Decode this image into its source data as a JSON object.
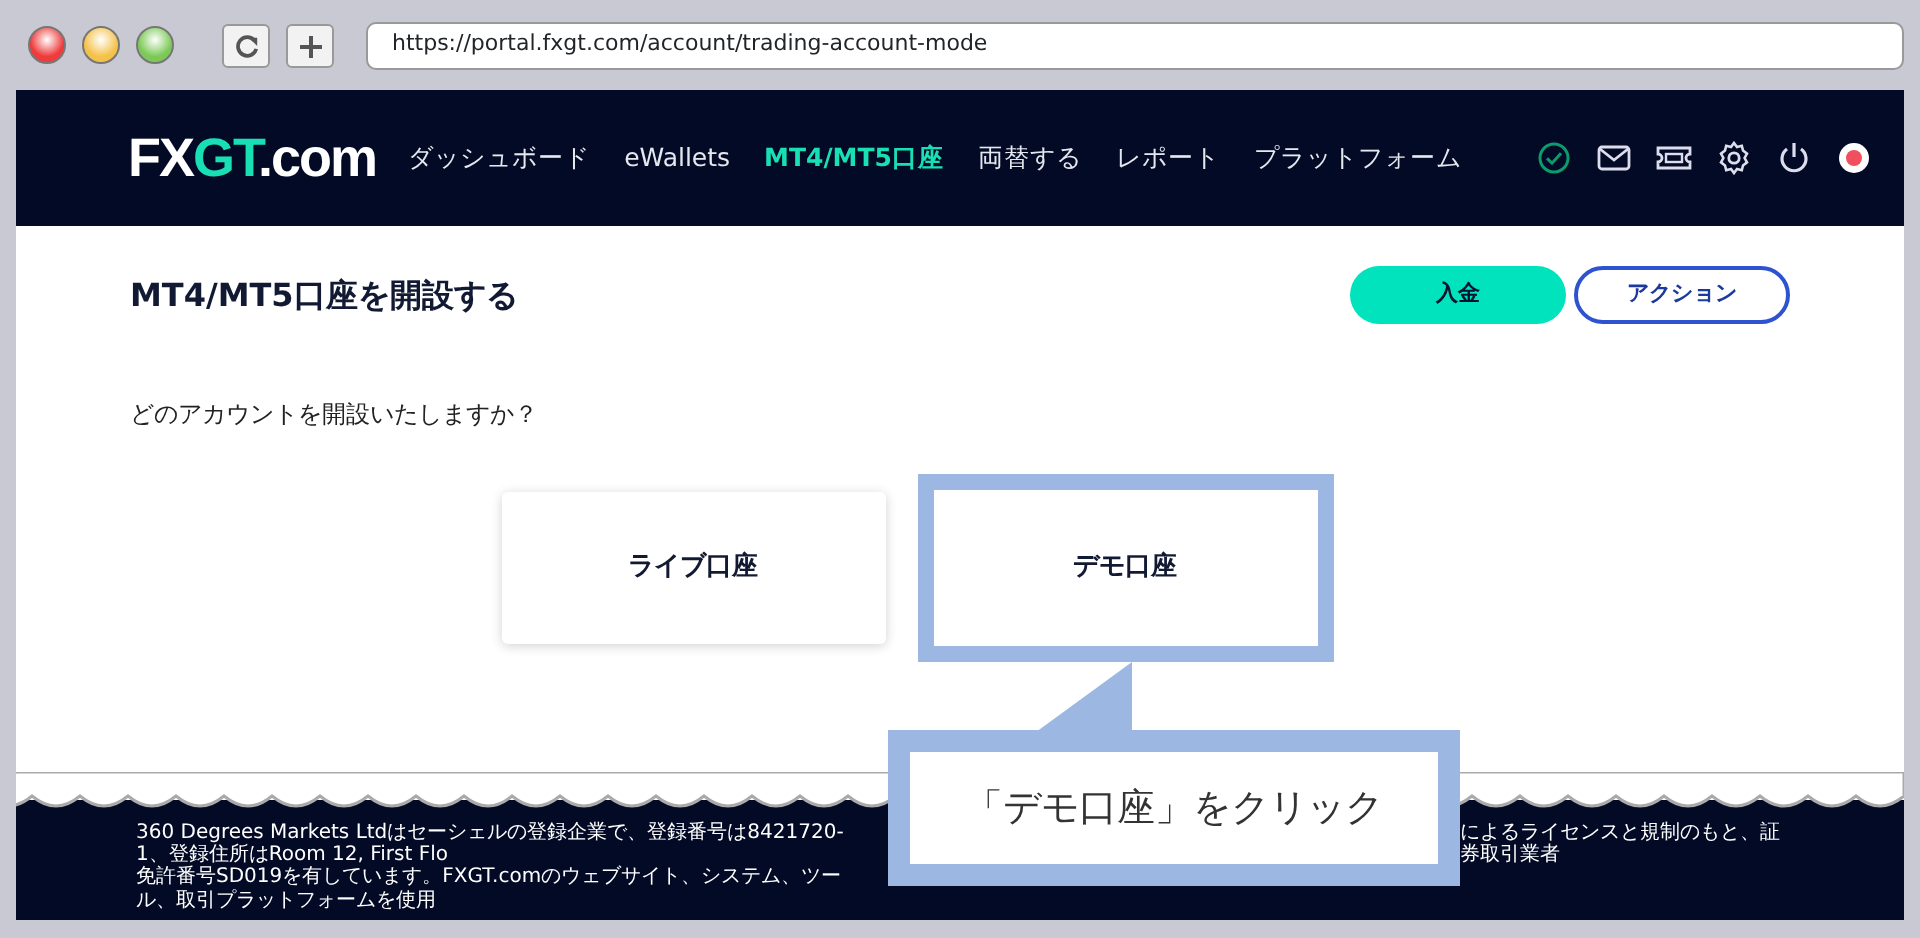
{
  "browser": {
    "url": "https://portal.fxgt.com/account/trading-account-mode"
  },
  "logo": [
    {
      "text": "FX",
      "accent": false
    },
    {
      "text": "GT",
      "accent": true
    },
    {
      "text": ".com",
      "accent": false
    }
  ],
  "nav": [
    {
      "label": "ダッシュボード",
      "selected": false
    },
    {
      "label": "eWallets",
      "selected": false
    },
    {
      "label": "MT4/MT5口座",
      "selected": true
    },
    {
      "label": "両替する",
      "selected": false
    },
    {
      "label": "レポート",
      "selected": false
    },
    {
      "label": "プラットフォーム",
      "selected": false
    }
  ],
  "page_title": "MT4/MT5口座を開設する",
  "buttons": [
    {
      "label": "入金",
      "kind": "filled"
    },
    {
      "label": "アクション",
      "kind": "outline"
    }
  ],
  "question": "どのアカウントを開設いたしますか？",
  "account_options": [
    {
      "label": "ライブ口座",
      "highlighted": false
    },
    {
      "label": "デモ口座",
      "highlighted": true
    }
  ],
  "callout": "「デモ口座」をクリック",
  "footer": {
    "left": [
      "360 Degrees Markets Ltdはセーシェルの登録企業で、登録番号は8421720-1、登録住所はRoom 12, First Flo",
      "免許番号SD019を有しています。FXGT.comのウェブサイト、システム、ツール、取引プラットフォームを使用"
    ],
    "right": [
      "によるライセンスと規制のもと、証券取引業者"
    ]
  }
}
